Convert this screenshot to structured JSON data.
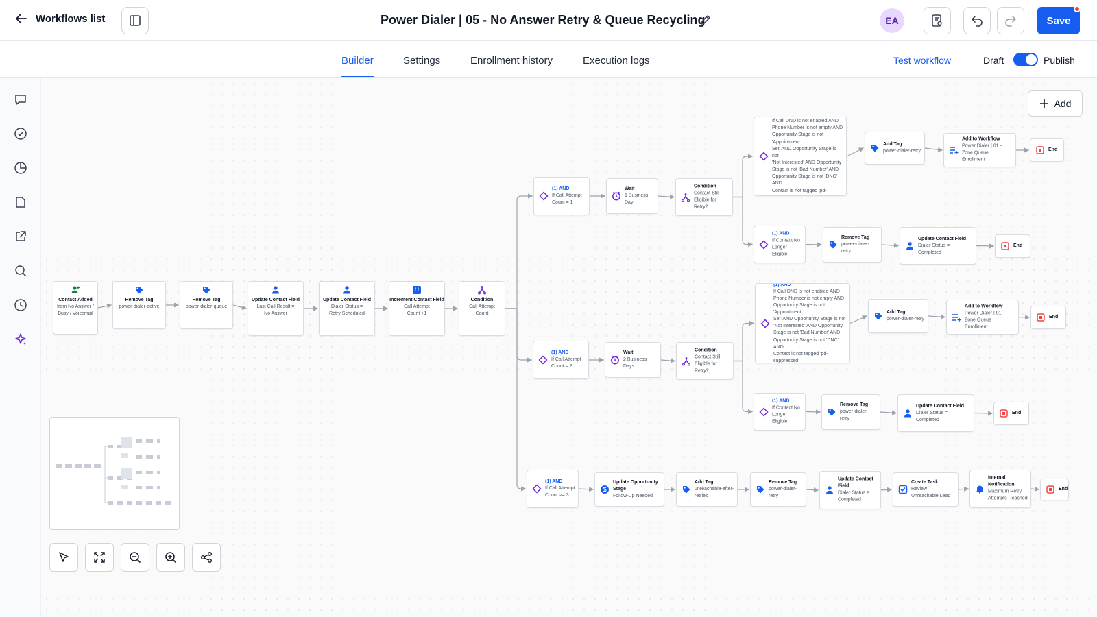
{
  "header": {
    "back_label": "Workflows list",
    "title": "Power Dialer | 05 - No Answer Retry & Queue Recycling",
    "avatar_initials": "EA",
    "save_label": "Save"
  },
  "tabs": {
    "builder": "Builder",
    "settings": "Settings",
    "enrollment": "Enrollment history",
    "execution": "Execution logs"
  },
  "actions": {
    "test_workflow": "Test workflow",
    "draft": "Draft",
    "publish": "Publish",
    "publish_on": true
  },
  "canvas": {
    "add_label": "Add"
  },
  "nodes": {
    "n1": {
      "title": "Contact Added",
      "lines": [
        "from No Answer /",
        "Busy / Voicemail"
      ]
    },
    "n2": {
      "title": "Remove Tag",
      "lines": [
        "power-dialer-active"
      ]
    },
    "n3": {
      "title": "Remove Tag",
      "lines": [
        "power-dialer-queue"
      ]
    },
    "n4": {
      "title": "Update Contact Field",
      "lines": [
        "Last Call Result =",
        "No Answer"
      ]
    },
    "n5": {
      "title": "Update Contact Field",
      "lines": [
        "Dialer Status =",
        "Retry Scheduled"
      ]
    },
    "n6": {
      "title": "Increment Contact Field",
      "lines": [
        "Call Attempt",
        "Count +1"
      ]
    },
    "n7": {
      "title": "Condition",
      "lines": [
        "Call Attempt",
        "Count"
      ]
    },
    "a1": {
      "cond": "(1) AND",
      "lines": [
        "If Call Attempt",
        "Count = 1"
      ]
    },
    "a2": {
      "title": "Wait",
      "lines": [
        "1 Business Day"
      ]
    },
    "a3": {
      "title": "Condition",
      "lines": [
        "Contact Still",
        "Eligible for Retry?"
      ]
    },
    "a4": {
      "cond": "(1) AND",
      "lines": [
        "If Call DND is not enabled AND",
        "Phone Number is not empty AND",
        "Opportunity Stage is not 'Appointment",
        "Set' AND Opportunity Stage is not",
        "'Not Interested' AND Opportunity",
        "Stage is not 'Bad Number' AND",
        "Opportunity Stage is not 'DNC' AND",
        "Contact is not tagged 'pd-suppressed'"
      ]
    },
    "a5": {
      "title": "Add Tag",
      "lines": [
        "power-dialer-retry"
      ]
    },
    "a6": {
      "title": "Add to Workflow",
      "lines": [
        "Power Dialer | 01 -",
        "Zone Queue Enrollment"
      ]
    },
    "a7": {
      "title": "End",
      "lines": []
    },
    "a8": {
      "cond": "(1) AND",
      "lines": [
        "If Contact No",
        "Longer Eligible"
      ]
    },
    "a9": {
      "title": "Remove Tag",
      "lines": [
        "power-dialer-retry"
      ]
    },
    "a10": {
      "title": "Update Contact Field",
      "lines": [
        "Dialer Status =",
        "Completed"
      ]
    },
    "a11": {
      "title": "End",
      "lines": []
    },
    "b1": {
      "cond": "(1) AND",
      "lines": [
        "If Call Attempt",
        "Count = 2"
      ]
    },
    "b2": {
      "title": "Wait",
      "lines": [
        "2 Business Days"
      ]
    },
    "b3": {
      "title": "Condition",
      "lines": [
        "Contact Still",
        "Eligible for Retry?"
      ]
    },
    "b4": {
      "cond": "(1) AND",
      "lines": [
        "If Call DND is not enabled AND",
        "Phone Number is not empty AND",
        "Opportunity Stage is not 'Appointment",
        "Set' AND Opportunity Stage is not",
        "'Not Interested' AND Opportunity",
        "Stage is not 'Bad Number' AND",
        "Opportunity Stage is not 'DNC' AND",
        "Contact is not tagged 'pd-suppressed'"
      ]
    },
    "b5": {
      "title": "Add Tag",
      "lines": [
        "power-dialer-retry"
      ]
    },
    "b6": {
      "title": "Add to Workflow",
      "lines": [
        "Power Dialer | 01 -",
        "Zone Queue Enrollment"
      ]
    },
    "b7": {
      "title": "End",
      "lines": []
    },
    "b8": {
      "cond": "(1) AND",
      "lines": [
        "If Contact No",
        "Longer Eligible"
      ]
    },
    "b9": {
      "title": "Remove Tag",
      "lines": [
        "power-dialer-retry"
      ]
    },
    "b10": {
      "title": "Update Contact Field",
      "lines": [
        "Dialer Status =",
        "Completed"
      ]
    },
    "b11": {
      "title": "End",
      "lines": []
    },
    "c1": {
      "cond": "(1) AND",
      "lines": [
        "If Call Attempt",
        "Count >= 3"
      ]
    },
    "c2": {
      "title": "Update Opportunity Stage",
      "lines": [
        "Follow-Up Needed"
      ]
    },
    "c3": {
      "title": "Add Tag",
      "lines": [
        "unreachable-after-retries"
      ]
    },
    "c4": {
      "title": "Remove Tag",
      "lines": [
        "power-dialer-retry"
      ]
    },
    "c5": {
      "title": "Update Contact Field",
      "lines": [
        "Dialer Status =",
        "Completed"
      ]
    },
    "c6": {
      "title": "Create Task",
      "lines": [
        "Review Unreachable Lead"
      ]
    },
    "c7": {
      "title": "Internal Notification",
      "lines": [
        "Maximum Retry",
        "Attempts Reached"
      ]
    },
    "c8": {
      "title": "End",
      "lines": []
    }
  },
  "node_icons": {
    "n1": "person-add-icon",
    "n2": "tag-icon",
    "n3": "tag-icon",
    "n4": "person-icon",
    "n5": "person-icon",
    "n6": "hash-icon",
    "n7": "branch-icon",
    "a1": "diamond-icon",
    "a2": "clock-icon",
    "a3": "branch-icon",
    "a4": "diamond-icon",
    "a5": "tag-icon",
    "a6": "list-add-icon",
    "a7": "end-icon",
    "a8": "diamond-icon",
    "a9": "tag-icon",
    "a10": "person-icon",
    "a11": "end-icon",
    "b1": "diamond-icon",
    "b2": "clock-icon",
    "b3": "branch-icon",
    "b4": "diamond-icon",
    "b5": "tag-icon",
    "b6": "list-add-icon",
    "b7": "end-icon",
    "b8": "diamond-icon",
    "b9": "tag-icon",
    "b10": "person-icon",
    "b11": "end-icon",
    "c1": "diamond-icon",
    "c2": "dollar-icon",
    "c3": "tag-icon",
    "c4": "tag-icon",
    "c5": "person-icon",
    "c6": "checkbox-icon",
    "c7": "bell-icon",
    "c8": "end-icon"
  },
  "colors": {
    "accent": "#155eef",
    "purple": "#6d28d9",
    "green": "#15803d",
    "end_red": "#ef4444",
    "edge": "#9ca3af"
  }
}
